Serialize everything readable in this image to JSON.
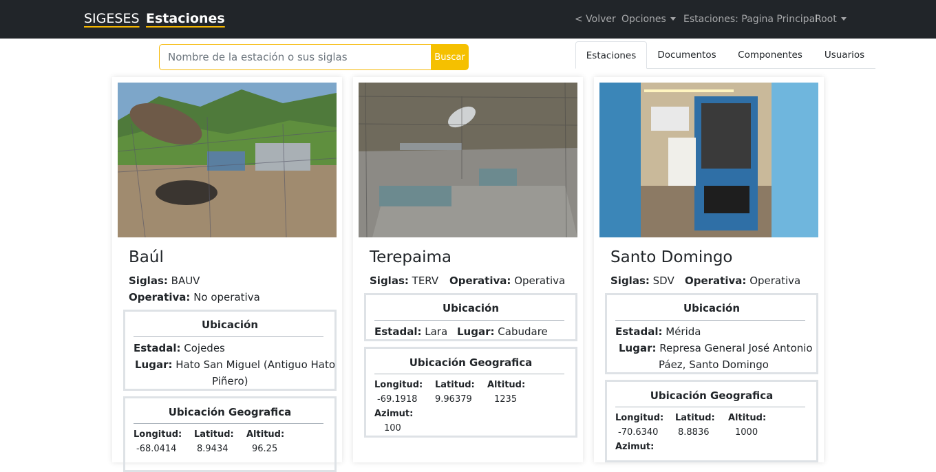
{
  "navbar": {
    "brand": "SIGESES",
    "section": "Estaciones",
    "back": "< Volver",
    "options": "Opciones",
    "home": "Estaciones: Pagina Principal",
    "user": "Root"
  },
  "search": {
    "placeholder": "Nombre de la estación o sus siglas",
    "button": "Buscar"
  },
  "tabs": [
    "Estaciones",
    "Documentos",
    "Componentes",
    "Usuarios"
  ],
  "labels": {
    "siglas": "Siglas:",
    "operativa": "Operativa:",
    "ubicacion": "Ubicación",
    "estadal": "Estadal:",
    "lugar": "Lugar:",
    "ubicacion_geo": "Ubicación Geografica",
    "longitud": "Longitud:",
    "latitud": "Latitud:",
    "altitud": "Altitud:",
    "azimut": "Azimut:"
  },
  "stations": [
    {
      "name": "Baúl",
      "siglas": "BAUV",
      "operativa": "No operativa",
      "estadal": "Cojedes",
      "lugar_line1": "Hato San Miguel (Antiguo Hato",
      "lugar_line2": "Piñero)",
      "longitud": "-68.0414",
      "latitud": "8.9434",
      "altitud": "96.25"
    },
    {
      "name": "Terepaima",
      "siglas": "TERV",
      "operativa": "Operativa",
      "estadal": "Lara",
      "lugar": "Cabudare",
      "longitud": "-69.1918",
      "latitud": "9.96379",
      "altitud": "1235",
      "azimut": "100"
    },
    {
      "name": "Santo Domingo",
      "siglas": "SDV",
      "operativa": "Operativa",
      "estadal": "Mérida",
      "lugar_line1": "Represa General José Antonio",
      "lugar_line2": "Páez, Santo Domingo",
      "longitud": "-70.6340",
      "latitud": "8.8836",
      "altitud": "1000"
    }
  ]
}
